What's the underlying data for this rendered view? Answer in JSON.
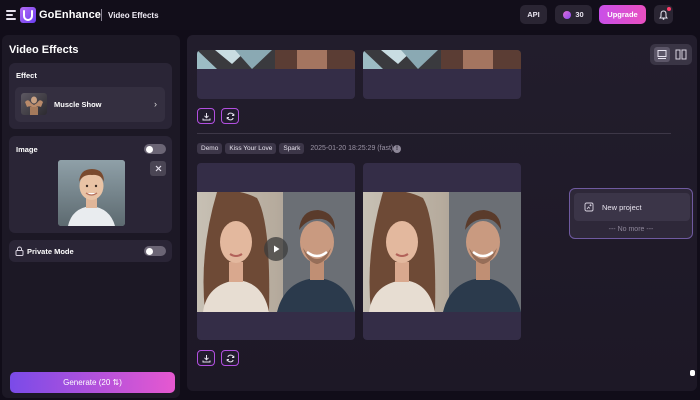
{
  "header": {
    "brand": "GoEnhance",
    "breadcrumb": "Video Effects",
    "api_label": "API",
    "credits": "30",
    "upgrade_label": "Upgrade"
  },
  "sidebar": {
    "title": "Video Effects",
    "effect_label": "Effect",
    "effect_name": "Muscle Show",
    "image_label": "Image",
    "private_label": "Private Mode",
    "generate_label": "Generate (20 ⇅)"
  },
  "main": {
    "tags": [
      "Demo",
      "Kiss Your Love",
      "Spark"
    ],
    "timestamp": "2025-01-20 18:25:29 (fast)",
    "info_glyph": "!"
  },
  "project_menu": {
    "new_project_label": "New project",
    "no_more_label": "--- No more ---"
  },
  "colors": {
    "accent": "#c94fe8",
    "background": "#110d19"
  }
}
